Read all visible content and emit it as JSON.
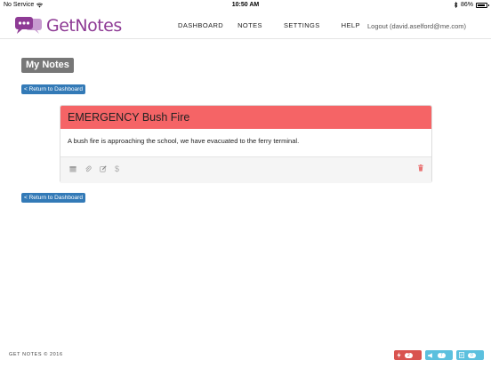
{
  "status_bar": {
    "carrier": "No Service",
    "time": "10:50 AM",
    "battery": "86%",
    "battery_level": 0.86
  },
  "header": {
    "logo_text": "GetNotes",
    "nav": {
      "dashboard": "DASHBOARD",
      "notes": "NOTES",
      "settings": "SETTINGS",
      "help": "HELP"
    },
    "logout": "Logout (david.aselford@me.com)"
  },
  "main": {
    "page_title": "My Notes",
    "return_top": "< Return to Dashboard",
    "return_bottom": "< Return to Dashboard",
    "note": {
      "title": "EMERGENCY Bush Fire",
      "body": "A bush fire is approaching the school, we have evacuated to the ferry terminal.",
      "accent_color": "#f56466",
      "actions": [
        "calendar-icon",
        "paperclip-icon",
        "edit-icon",
        "dollar-icon",
        "trash-icon"
      ],
      "dollar_label": "$"
    }
  },
  "footer": {
    "copyright": "GET NOTES © 2016",
    "badges": [
      {
        "icon": "bolt-icon",
        "count": "2",
        "color": "#d9534f"
      },
      {
        "icon": "megaphone-icon",
        "count": "7",
        "color": "#5bc0de"
      },
      {
        "icon": "document-icon",
        "count": "0",
        "color": "#5bc0de"
      }
    ]
  }
}
